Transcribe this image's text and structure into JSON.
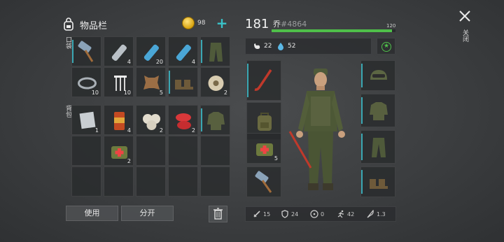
{
  "inventory": {
    "title": "物品栏",
    "coins": "98",
    "pocket_label": "口袋",
    "backpack_label": "背包",
    "pocket_slots": [
      {
        "icon": "sledgehammer-icon",
        "qty": ""
      },
      {
        "icon": "empty-bottle-icon",
        "qty": "4"
      },
      {
        "icon": "water-bottle-icon",
        "qty": "20"
      },
      {
        "icon": "water-bottle-icon",
        "qty": "4"
      },
      {
        "icon": "camo-pants-icon",
        "qty": ""
      },
      {
        "icon": "wire-coil-icon",
        "qty": "10"
      },
      {
        "icon": "nails-icon",
        "qty": "10"
      },
      {
        "icon": "leather-hide-icon",
        "qty": "5"
      },
      {
        "icon": "boots-icon",
        "qty": ""
      },
      {
        "icon": "rope-spool-icon",
        "qty": "2"
      }
    ],
    "backpack_slots": [
      {
        "icon": "metal-sheet-icon",
        "qty": "1"
      },
      {
        "icon": "canned-food-icon",
        "qty": "4"
      },
      {
        "icon": "onion-icon",
        "qty": "2"
      },
      {
        "icon": "raw-meat-icon",
        "qty": "2"
      },
      {
        "icon": "camo-jacket-icon",
        "qty": ""
      },
      {
        "icon": "empty-slot",
        "qty": ""
      },
      {
        "icon": "first-aid-bag-icon",
        "qty": "2"
      },
      {
        "icon": "empty-slot",
        "qty": ""
      },
      {
        "icon": "empty-slot",
        "qty": ""
      },
      {
        "icon": "empty-slot",
        "qty": ""
      },
      {
        "icon": "empty-slot",
        "qty": ""
      },
      {
        "icon": "empty-slot",
        "qty": ""
      },
      {
        "icon": "empty-slot",
        "qty": ""
      },
      {
        "icon": "empty-slot",
        "qty": ""
      },
      {
        "icon": "empty-slot",
        "qty": ""
      }
    ],
    "use_label": "使用",
    "split_label": "分开"
  },
  "character": {
    "level": "181",
    "name": "乔",
    "id": "#4864",
    "xp_max": "120",
    "xp_fraction": 0.97,
    "hunger": "22",
    "thirst": "52",
    "weapon_slot": {
      "icon": "hockey-stick-icon"
    },
    "left_slots": [
      {
        "icon": "backpack-icon",
        "qty": ""
      },
      {
        "icon": "first-aid-bag-icon",
        "qty": "5"
      },
      {
        "icon": "sledgehammer-icon",
        "qty": ""
      }
    ],
    "right_slots": [
      {
        "icon": "camo-helmet-icon"
      },
      {
        "icon": "camo-jacket-icon"
      },
      {
        "icon": "camo-pants-icon"
      },
      {
        "icon": "boots-icon"
      }
    ],
    "stats": {
      "attack": "15",
      "defense": "24",
      "radiation": "0",
      "speed": "42",
      "weight": "1.3"
    }
  },
  "close_label": "关闭",
  "colors": {
    "accent": "#3aa7b3",
    "xp_green": "#4fbf4a",
    "coin_gold": "#d8a410"
  }
}
